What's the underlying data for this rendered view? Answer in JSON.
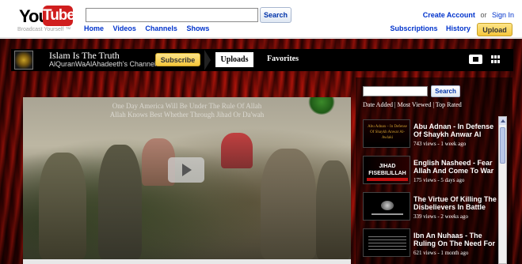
{
  "masthead": {
    "logo_you": "You",
    "logo_tube": "Tube",
    "tagline": "Broadcast Yourself ™",
    "search_value": "",
    "search_button": "Search",
    "nav": [
      "Home",
      "Videos",
      "Channels",
      "Shows"
    ],
    "create_account": "Create Account",
    "or": "or",
    "sign_in": "Sign In",
    "subscriptions": "Subscriptions",
    "history": "History",
    "upload": "Upload"
  },
  "channel": {
    "title": "Islam Is The Truth",
    "username": "AlQuranWaAlAhadeeth's Channel",
    "subscribe": "Subscribe",
    "tabs": [
      "Uploads",
      "Favorites"
    ],
    "icons": [
      "player-view-icon",
      "grid-view-icon"
    ]
  },
  "player": {
    "overlay_line1": "One Day America Will Be Under The Rule Of Allah",
    "overlay_line2": "Allah Knows Best Whether Through Jihad Or Da'wah"
  },
  "sidebar": {
    "search_value": "",
    "search_button": "Search",
    "sort": [
      "Date Added",
      "Most Viewed",
      "Top Rated"
    ],
    "sort_separator": "|",
    "videos": [
      {
        "title": "Abu Adnan - In Defense Of Shaykh Anwar Al",
        "meta": "743 views - 1 week ago",
        "thumb_text": "Abu Adnan – In Defense Of Shaykh Anwar Al-Awlaki"
      },
      {
        "title": "English Nasheed - Fear Allah And Come To War",
        "meta": "175 views - 5 days ago",
        "thumb_text": "JIHAD FISEBILILLAH"
      },
      {
        "title": "The Virtue Of Killing The Disbelievers In Battle",
        "meta": "339 views - 2 weeks ago",
        "thumb_text": ""
      },
      {
        "title": "Ibn An Nuhaas - The Ruling On The Need For",
        "meta": "621 views - 1 month ago",
        "thumb_text": ""
      }
    ]
  },
  "colors": {
    "brand_red": "#d01e1e",
    "link_blue": "#0033cc",
    "upload_yellow": "#f5c63b",
    "channel_red": "#7a0905"
  }
}
